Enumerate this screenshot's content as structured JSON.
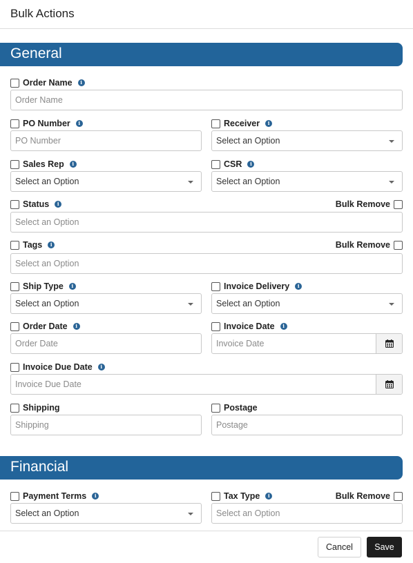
{
  "modal": {
    "title": "Bulk Actions"
  },
  "sections": {
    "general": "General",
    "financial": "Financial"
  },
  "bulk_remove_label": "Bulk Remove",
  "fields": {
    "order_name": {
      "label": "Order Name",
      "placeholder": "Order Name"
    },
    "po_number": {
      "label": "PO Number",
      "placeholder": "PO Number"
    },
    "receiver": {
      "label": "Receiver",
      "value": "Select an Option"
    },
    "sales_rep": {
      "label": "Sales Rep",
      "value": "Select an Option"
    },
    "csr": {
      "label": "CSR",
      "value": "Select an Option"
    },
    "status": {
      "label": "Status",
      "placeholder": "Select an Option"
    },
    "tags": {
      "label": "Tags",
      "placeholder": "Select an Option"
    },
    "ship_type": {
      "label": "Ship Type",
      "value": "Select an Option"
    },
    "invoice_delivery": {
      "label": "Invoice Delivery",
      "value": "Select an Option"
    },
    "order_date": {
      "label": "Order Date",
      "placeholder": "Order Date"
    },
    "invoice_date": {
      "label": "Invoice Date",
      "placeholder": "Invoice Date"
    },
    "invoice_due_date": {
      "label": "Invoice Due Date",
      "placeholder": "Invoice Due Date"
    },
    "shipping": {
      "label": "Shipping",
      "placeholder": "Shipping"
    },
    "postage": {
      "label": "Postage",
      "placeholder": "Postage"
    },
    "payment_terms": {
      "label": "Payment Terms",
      "value": "Select an Option"
    },
    "tax_type": {
      "label": "Tax Type",
      "placeholder": "Select an Option"
    }
  },
  "footer": {
    "cancel": "Cancel",
    "save": "Save"
  },
  "icons": {
    "info": "info-circle-icon",
    "calendar": "calendar-icon",
    "dropdown": "chevron-down-icon"
  },
  "colors": {
    "section_bar": "#22649a",
    "info_icon": "#2a6496",
    "save_button": "#1e1e1e"
  }
}
